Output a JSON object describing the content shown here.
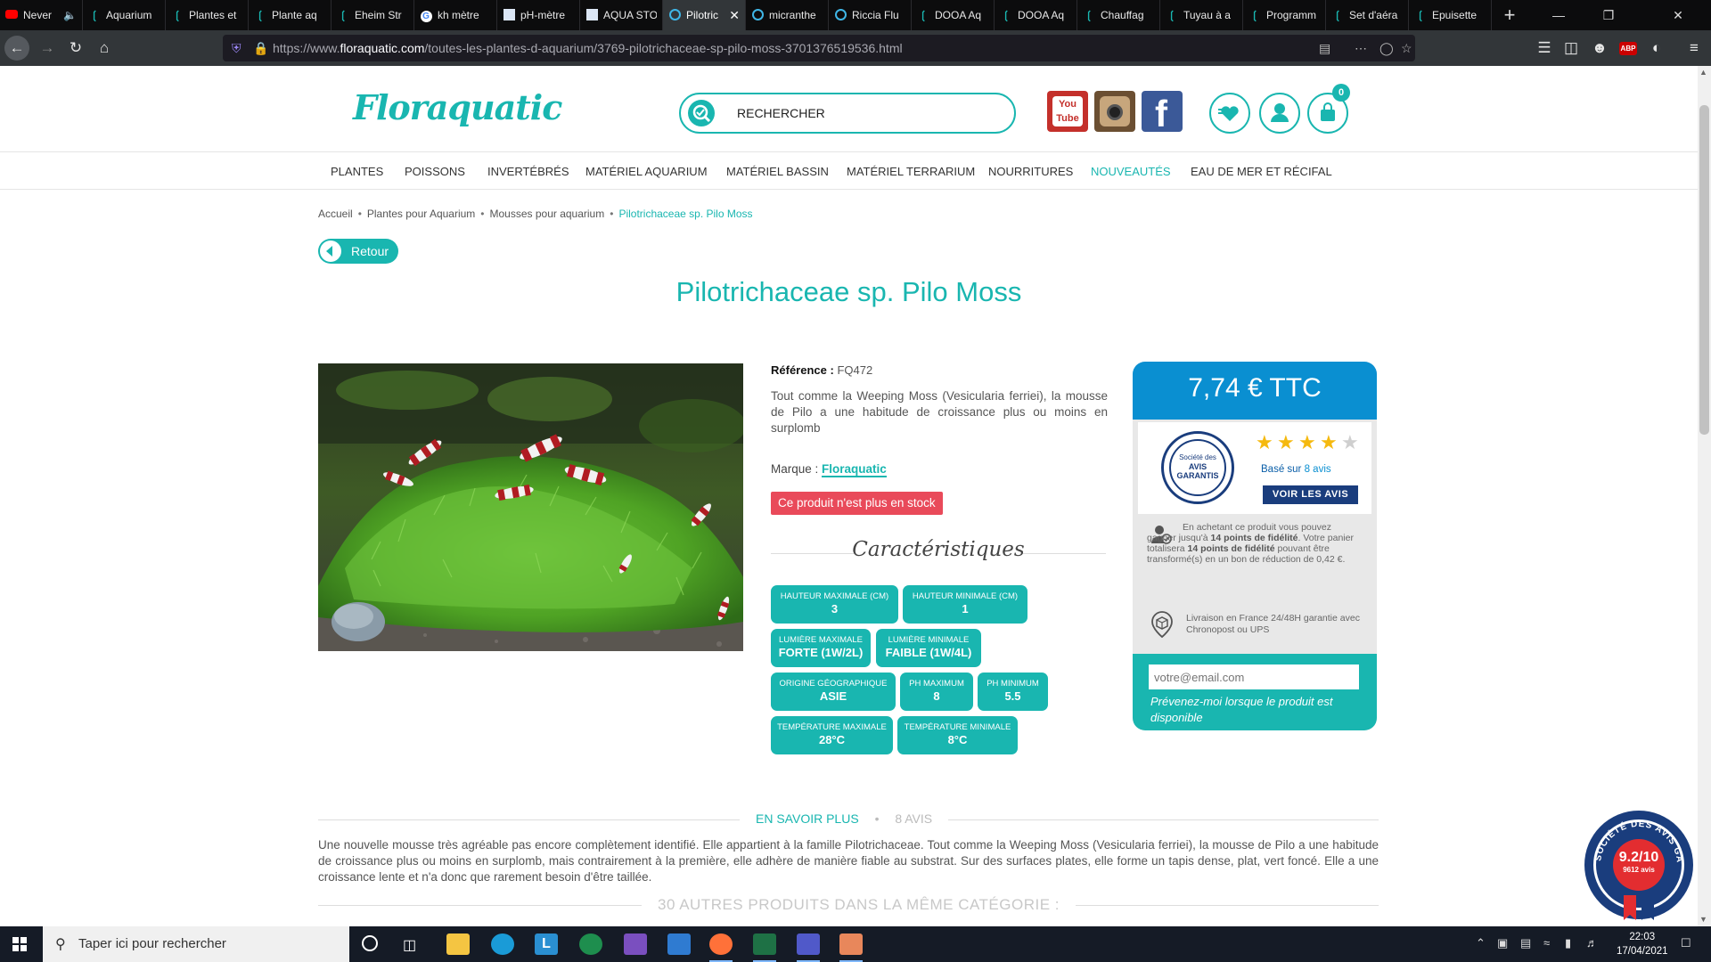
{
  "browser": {
    "tabs": [
      {
        "title": "Never",
        "favicon": "youtube-icon",
        "audio": true
      },
      {
        "title": "Aquarium",
        "favicon": "floraquatic-icon"
      },
      {
        "title": "Plantes et",
        "favicon": "floraquatic-icon"
      },
      {
        "title": "Plante aq",
        "favicon": "floraquatic-icon"
      },
      {
        "title": "Eheim Str",
        "favicon": "floraquatic-icon"
      },
      {
        "title": "kh mètre",
        "favicon": "google-icon"
      },
      {
        "title": "pH-mètre",
        "favicon": "site-icon"
      },
      {
        "title": "AQUA STO",
        "favicon": "site-icon"
      },
      {
        "title": "Pilotric",
        "favicon": "globe-icon",
        "active": true
      },
      {
        "title": "micranthe",
        "favicon": "globe-icon"
      },
      {
        "title": "Riccia Flu",
        "favicon": "globe-icon"
      },
      {
        "title": "DOOA Aq",
        "favicon": "floraquatic-icon"
      },
      {
        "title": "DOOA Aq",
        "favicon": "floraquatic-icon"
      },
      {
        "title": "Chauffag",
        "favicon": "floraquatic-icon"
      },
      {
        "title": "Tuyau à a",
        "favicon": "floraquatic-icon"
      },
      {
        "title": "Programm",
        "favicon": "floraquatic-icon"
      },
      {
        "title": "Set d'aéra",
        "favicon": "floraquatic-icon"
      },
      {
        "title": "Epuisette",
        "favicon": "floraquatic-icon"
      }
    ],
    "url_prefix": "https://www.",
    "url_host": "floraquatic.com",
    "url_path": "/toutes-les-plantes-d-aquarium/3769-pilotrichaceae-sp-pilo-moss-3701376519536.html",
    "abp_label": "ABP"
  },
  "site": {
    "logo": "Floraquatic",
    "search_placeholder": "RECHERCHER",
    "youtube_label": "You\nTube",
    "cart_count": "0",
    "menu": [
      "PLANTES",
      "POISSONS",
      "INVERTÉBRÉS",
      "MATÉRIEL AQUARIUM",
      "MATÉRIEL BASSIN",
      "MATÉRIEL TERRARIUM",
      "NOURRITURES",
      "NOUVEAUTÉS",
      "EAU DE MER ET RÉCIFAL"
    ],
    "menu_highlight": "NOUVEAUTÉS",
    "accent_color": "#19b6b0"
  },
  "breadcrumb": [
    "Accueil",
    "Plantes pour Aquarium",
    "Mousses pour aquarium",
    "Pilotrichaceae sp. Pilo Moss"
  ],
  "back_label": "Retour",
  "product": {
    "title": "Pilotrichaceae sp. Pilo Moss",
    "reference_label": "Référence :",
    "reference": "FQ472",
    "description": "Tout comme la Weeping Moss (Vesicularia ferriei), la mousse de Pilo a une habitude de croissance plus ou moins en surplomb",
    "brand_label": "Marque :",
    "brand": "Floraquatic",
    "stock_status": "Ce produit n'est plus en stock",
    "characteristics_title": "Caractéristiques",
    "characteristics": [
      {
        "label": "Hauteur maximale (cm)",
        "value": "3"
      },
      {
        "label": "Hauteur minimale (cm)",
        "value": "1"
      },
      {
        "label": "Lumière maximale",
        "value": "FORTE (1W/2L)"
      },
      {
        "label": "Lumière minimale",
        "value": "FAIBLE (1W/4L)"
      },
      {
        "label": "Origine géographique",
        "value": "ASIE"
      },
      {
        "label": "PH maximum",
        "value": "8"
      },
      {
        "label": "PH minimum",
        "value": "5.5"
      },
      {
        "label": "Température maximale",
        "value": "28°C"
      },
      {
        "label": "Température minimale",
        "value": "8°C"
      }
    ]
  },
  "price_panel": {
    "price": "7,74 € TTC",
    "seal_line1": "Société des",
    "seal_line2": "AVIS",
    "seal_line3": "GARANTIS",
    "rating_stars": 4,
    "rating_max": 5,
    "based_on_prefix": "Basé sur ",
    "based_on_count": "8 avis",
    "see_reviews": "VOIR LES AVIS",
    "loyalty_part1": "En achetant ce produit vous pouvez gagner jusqu'à ",
    "loyalty_points": "14 points de fidélité",
    "loyalty_part2": ". Votre panier totalisera ",
    "loyalty_points2": "14 points de fidélité",
    "loyalty_part3": " pouvant être transformé(s) en un bon de réduction de 0,42 €.",
    "delivery": "Livraison en France 24/48H garantie avec Chronopost ou UPS",
    "email_placeholder": "votre@email.com",
    "notify_text": "Prévenez-moi lorsque le produit est disponible"
  },
  "info_tabs": {
    "tab_more": "EN SAVOIR PLUS",
    "tab_reviews": "8 AVIS",
    "long_description": "Une nouvelle mousse très agréable pas encore complètement identifié. Elle appartient à la famille Pilotrichaceae. Tout comme la Weeping Moss (Vesicularia ferriei), la mousse de Pilo a une habitude de croissance plus ou moins en surplomb, mais contrairement à la première, elle adhère de manière fiable au substrat. Sur des surfaces plates, elle forme un tapis dense, plat, vert foncé. Elle a une croissance lente et n'a donc que rarement besoin d'être taillée.",
    "same_category": "30 AUTRES PRODUITS DANS LA MÊME CATÉGORIE :"
  },
  "badge": {
    "score": "9.2/10",
    "count": "9612 avis",
    "ring_text": "SOCIÉTÉ DES AVIS GARANTIS"
  },
  "taskbar": {
    "search_placeholder": "Taper ici pour rechercher",
    "time": "22:03",
    "date": "17/04/2021"
  }
}
